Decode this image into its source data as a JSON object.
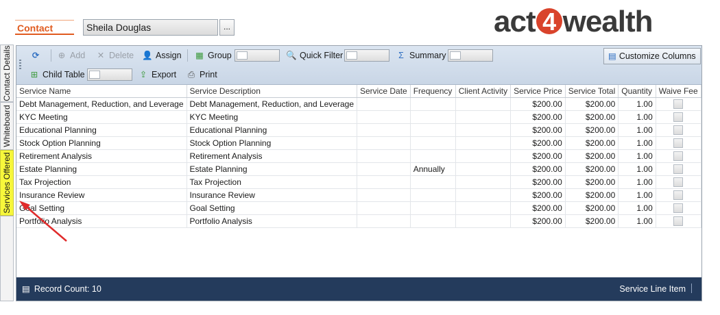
{
  "header": {
    "contact_label": "Contact",
    "contact_value": "Sheila Douglas",
    "more_button": "...",
    "logo_text_a": "act",
    "logo_text_4": "4",
    "logo_text_b": "wealth"
  },
  "tabs": [
    {
      "label": "Contact Details"
    },
    {
      "label": "Whiteboard"
    },
    {
      "label": "Services Offered"
    }
  ],
  "toolbar": {
    "add": "Add",
    "delete": "Delete",
    "assign": "Assign",
    "group": "Group",
    "quick_filter": "Quick Filter",
    "summary": "Summary",
    "customize_columns": "Customize Columns",
    "child_table": "Child Table",
    "export": "Export",
    "print": "Print"
  },
  "columns": [
    "Service Name",
    "Service Description",
    "Service Date",
    "Frequency",
    "Client Activity",
    "Service Price",
    "Service Total",
    "Quantity",
    "Waive Fee"
  ],
  "rows": [
    {
      "name": "Debt Management, Reduction, and Leverage",
      "desc": "Debt Management, Reduction, and Leverage",
      "date": "",
      "freq": "",
      "activity": "",
      "price": "$200.00",
      "total": "$200.00",
      "qty": "1.00"
    },
    {
      "name": "KYC Meeting",
      "desc": "KYC Meeting",
      "date": "",
      "freq": "",
      "activity": "",
      "price": "$200.00",
      "total": "$200.00",
      "qty": "1.00"
    },
    {
      "name": "Educational Planning",
      "desc": "Educational Planning",
      "date": "",
      "freq": "",
      "activity": "",
      "price": "$200.00",
      "total": "$200.00",
      "qty": "1.00"
    },
    {
      "name": "Stock Option Planning",
      "desc": "Stock Option Planning",
      "date": "",
      "freq": "",
      "activity": "",
      "price": "$200.00",
      "total": "$200.00",
      "qty": "1.00"
    },
    {
      "name": "Retirement Analysis",
      "desc": "Retirement Analysis",
      "date": "",
      "freq": "",
      "activity": "",
      "price": "$200.00",
      "total": "$200.00",
      "qty": "1.00"
    },
    {
      "name": "Estate Planning",
      "desc": "Estate Planning",
      "date": "",
      "freq": "Annually",
      "activity": "",
      "price": "$200.00",
      "total": "$200.00",
      "qty": "1.00"
    },
    {
      "name": "Tax Projection",
      "desc": "Tax Projection",
      "date": "",
      "freq": "",
      "activity": "",
      "price": "$200.00",
      "total": "$200.00",
      "qty": "1.00"
    },
    {
      "name": "Insurance Review",
      "desc": "Insurance Review",
      "date": "",
      "freq": "",
      "activity": "",
      "price": "$200.00",
      "total": "$200.00",
      "qty": "1.00"
    },
    {
      "name": "Goal Setting",
      "desc": "Goal Setting",
      "date": "",
      "freq": "",
      "activity": "",
      "price": "$200.00",
      "total": "$200.00",
      "qty": "1.00"
    },
    {
      "name": "Portfolio Analysis",
      "desc": "Portfolio Analysis",
      "date": "",
      "freq": "",
      "activity": "",
      "price": "$200.00",
      "total": "$200.00",
      "qty": "1.00"
    }
  ],
  "status": {
    "record_count": "Record Count: 10",
    "entity": "Service Line Item"
  },
  "colors": {
    "accent_orange": "#e05a1e",
    "active_tab": "#f7f73b",
    "status_bar": "#243b5c",
    "annotation_arrow": "#e02b2b"
  }
}
